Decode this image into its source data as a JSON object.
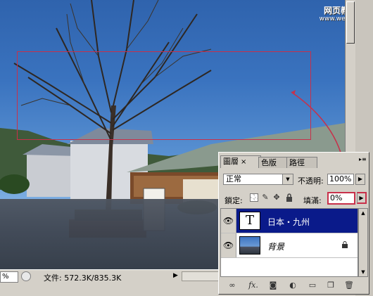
{
  "watermark": {
    "line1": "网页教学网",
    "line2": "www.webjx.com"
  },
  "status_bar": {
    "zoom": "%",
    "doc_info": "文件: 572.3K/835.3K",
    "arrow": "▶"
  },
  "layers_panel": {
    "tabs": [
      {
        "label": "圖層",
        "close": "×",
        "active": true
      },
      {
        "label": "色版",
        "active": false
      },
      {
        "label": "路徑",
        "active": false
      }
    ],
    "menu_icon": "▸≡",
    "blend_mode": "正常",
    "opacity_label": "不透明:",
    "opacity_value": "100%",
    "lock_label": "鎖定:",
    "fill_label": "填滿:",
    "fill_value": "0%",
    "layers": [
      {
        "thumb_text": "T",
        "name": "日本・九州",
        "selected": true,
        "visible": true
      },
      {
        "name": "背景",
        "selected": false,
        "visible": true,
        "locked": true
      }
    ],
    "footer_icons": [
      "link-icon",
      "fx-icon",
      "mask-icon",
      "adjustment-icon",
      "folder-icon",
      "new-layer-icon",
      "trash-icon"
    ],
    "footer_labels": {
      "fx": "fx."
    }
  },
  "colors": {
    "selection": "#c8304a",
    "selected_layer": "#0a1a8a",
    "panel_bg": "#d4d0c8"
  }
}
